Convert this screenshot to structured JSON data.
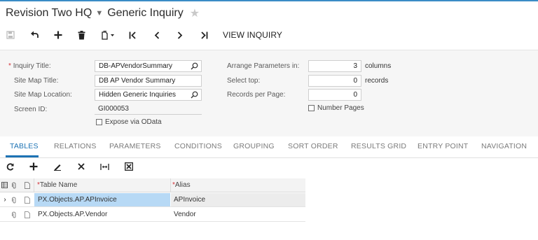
{
  "header": {
    "company": "Revision Two HQ",
    "screen_title": "Generic Inquiry"
  },
  "toolbar": {
    "view_inquiry_label": "VIEW INQUIRY"
  },
  "form": {
    "inquiry_title": {
      "label": "Inquiry Title:",
      "required_mark": "*",
      "value": "DB-APVendorSummary"
    },
    "site_map_title": {
      "label": "Site Map Title:",
      "value": "DB AP Vendor Summary"
    },
    "site_map_location": {
      "label": "Site Map Location:",
      "value": "Hidden Generic Inquiries"
    },
    "screen_id": {
      "label": "Screen ID:",
      "value": "GI000053"
    },
    "expose_via_odata": {
      "label": "Expose via OData",
      "checked": false
    },
    "arrange_parameters": {
      "label": "Arrange Parameters in:",
      "value": "3",
      "unit": "columns"
    },
    "select_top": {
      "label": "Select top:",
      "value": "0",
      "unit": "records"
    },
    "records_per_page": {
      "label": "Records per Page:",
      "value": "0"
    },
    "number_pages": {
      "label": "Number Pages",
      "checked": false
    }
  },
  "tabs": [
    {
      "label": "TABLES",
      "active": true
    },
    {
      "label": "RELATIONS"
    },
    {
      "label": "PARAMETERS"
    },
    {
      "label": "CONDITIONS"
    },
    {
      "label": "GROUPING"
    },
    {
      "label": "SORT ORDER"
    },
    {
      "label": "RESULTS GRID"
    },
    {
      "label": "ENTRY POINT"
    },
    {
      "label": "NAVIGATION"
    }
  ],
  "grid": {
    "columns": {
      "table_name": "Table Name",
      "alias": "Alias",
      "required_mark": "*"
    },
    "rows": [
      {
        "table_name": "PX.Objects.AP.APInvoice",
        "alias": "APInvoice",
        "selected": true
      },
      {
        "table_name": "PX.Objects.AP.Vendor",
        "alias": "Vendor",
        "selected": false
      }
    ]
  },
  "colors": {
    "accent": "#1d73b4",
    "selected_row": "#b7d9f5",
    "required": "#d4343b"
  },
  "icons": {
    "toolbar": [
      "save-icon",
      "undo-icon",
      "add-icon",
      "delete-icon",
      "copy-paste-icon",
      "first-record-icon",
      "previous-record-icon",
      "next-record-icon",
      "last-record-icon"
    ],
    "grid_toolbar": [
      "refresh-icon",
      "add-row-icon",
      "edit-icon",
      "delete-row-icon",
      "fit-columns-icon",
      "export-excel-icon"
    ]
  }
}
